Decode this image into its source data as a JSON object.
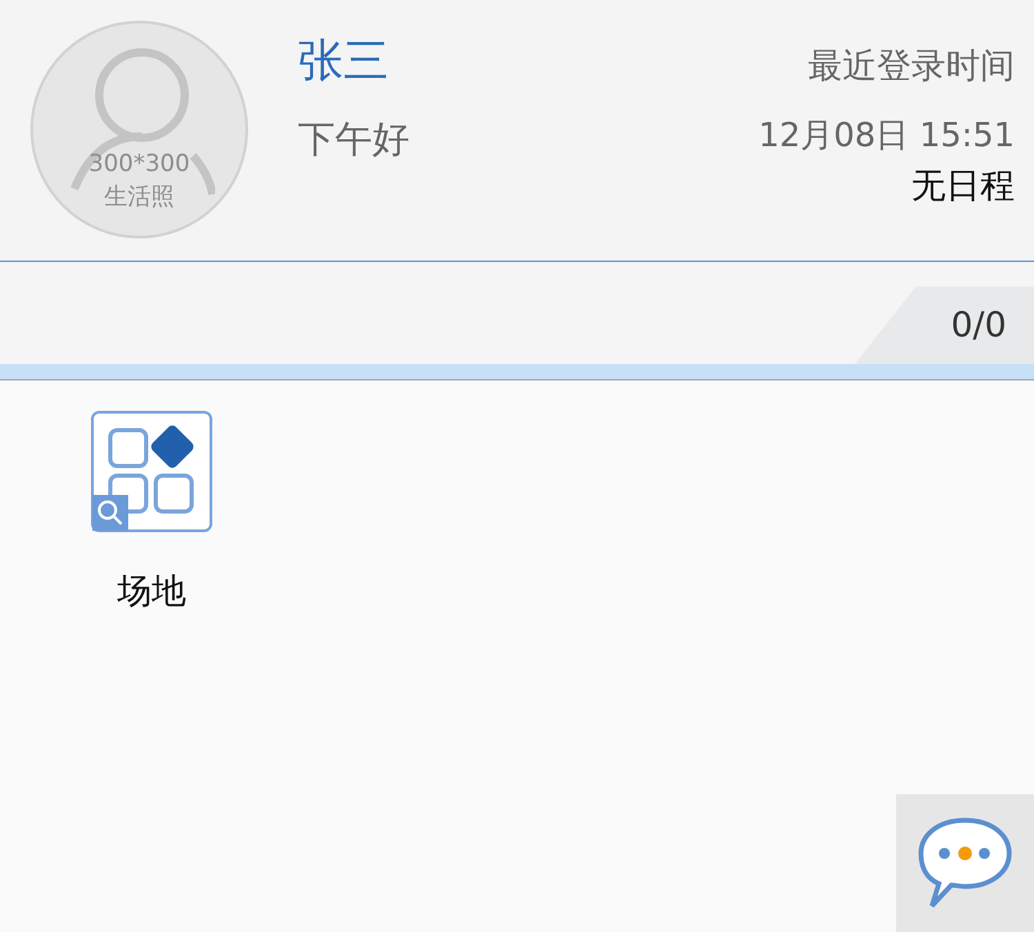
{
  "profile": {
    "avatar_text": [
      "300*300",
      "生活照"
    ],
    "name": "张三",
    "greeting": "下午好",
    "last_login_label": "最近登录时间",
    "last_login_time": "12月08日 15:51",
    "schedule": "无日程"
  },
  "counter": "0/0",
  "apps": [
    {
      "label": "场地"
    }
  ]
}
